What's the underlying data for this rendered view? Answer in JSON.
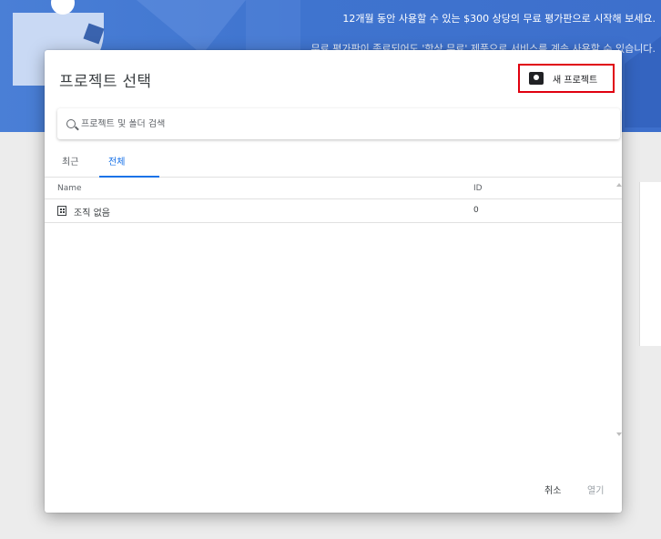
{
  "background": {
    "banner_line1": "12개월 동안 사용할 수 있는 $300 상당의 무료 평가판으로 시작해 보세요.",
    "banner_line2": "무료 평가판이 종료되어도 '항상 무료' 제품으로 서비스를 계속 사용할 수 있습니다."
  },
  "dialog": {
    "title": "프로젝트 선택",
    "new_project_label": "새 프로젝트",
    "search_placeholder": "프로젝트 및 폴더 검색",
    "tabs": [
      {
        "label": "최근"
      },
      {
        "label": "전체"
      }
    ],
    "table": {
      "columns": {
        "name": "Name",
        "id": "ID"
      },
      "rows": [
        {
          "name": "조직 없음",
          "id": "0"
        }
      ]
    },
    "footer": {
      "cancel_label": "취소",
      "open_label": "열기"
    }
  },
  "colors": {
    "accent": "#1a73e8",
    "highlight_box": "#e0000f",
    "hero_blue": "#3f74cf"
  },
  "icons": {
    "new_project": "camera-folder-icon",
    "search": "search-icon",
    "org": "building-icon"
  }
}
